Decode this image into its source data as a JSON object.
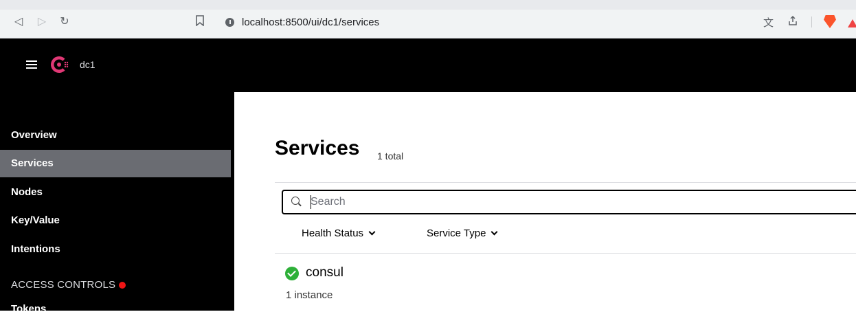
{
  "browser": {
    "url": "localhost:8500/ui/dc1/services",
    "nav_icons": [
      "back-icon",
      "forward-icon",
      "reload-icon",
      "bookmark-icon"
    ],
    "right_icons": [
      "translate-icon",
      "share-icon",
      "brave-shield-icon",
      "brave-rewards-icon"
    ]
  },
  "header": {
    "datacenter": "dc1",
    "brand_color": "#e03875"
  },
  "sidebar": {
    "items": [
      {
        "label": "Overview",
        "active": false
      },
      {
        "label": "Services",
        "active": true
      },
      {
        "label": "Nodes",
        "active": false
      },
      {
        "label": "Key/Value",
        "active": false
      },
      {
        "label": "Intentions",
        "active": false
      }
    ],
    "access_controls": {
      "heading": "ACCESS CONTROLS",
      "items": [
        {
          "label": "Tokens"
        }
      ]
    }
  },
  "main": {
    "title": "Services",
    "count": "1 total",
    "search": {
      "placeholder": "Search",
      "value": ""
    },
    "filters": [
      {
        "label": "Health Status"
      },
      {
        "label": "Service Type"
      }
    ],
    "services": [
      {
        "name": "consul",
        "meta": "1 instance",
        "status_color": "#2eb039"
      }
    ]
  }
}
